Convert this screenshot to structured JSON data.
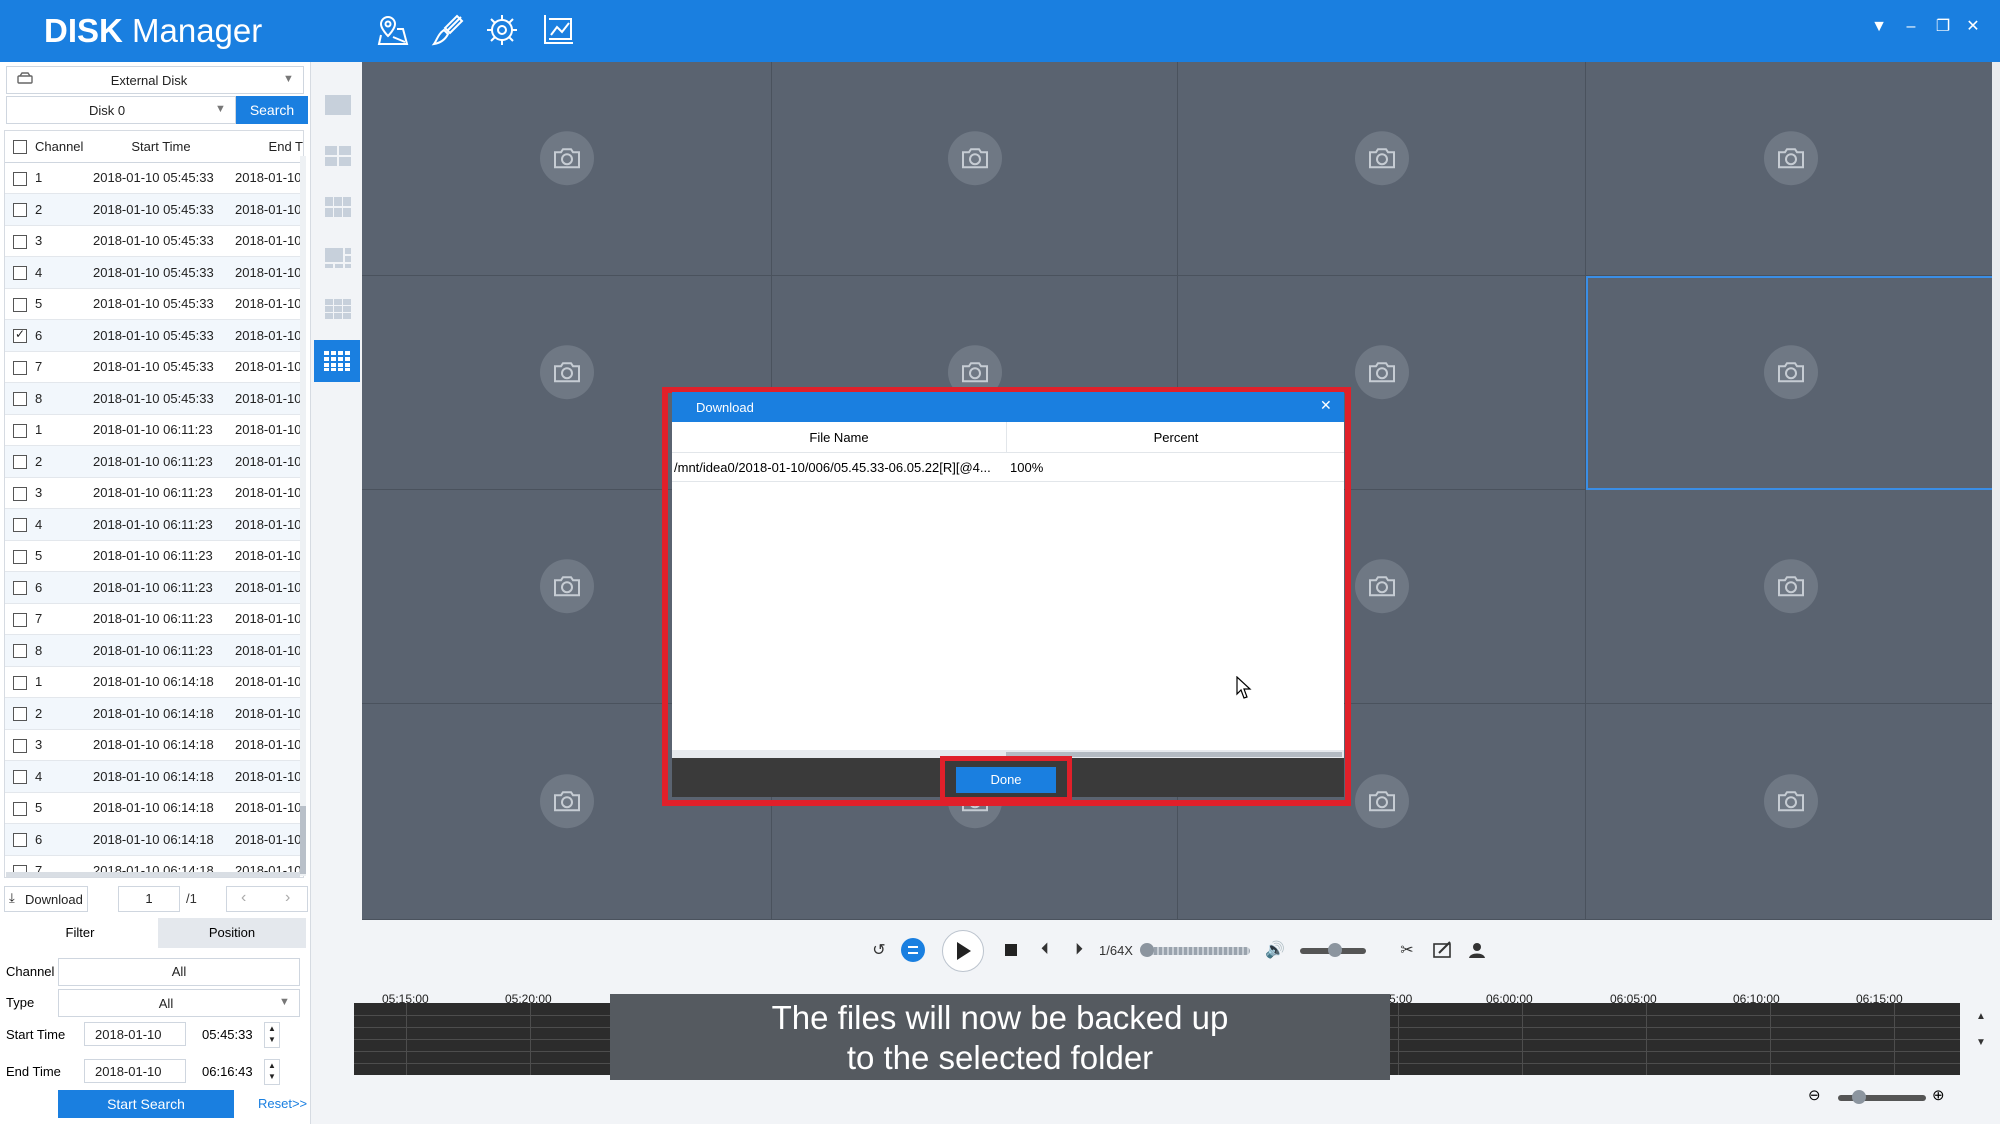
{
  "app": {
    "title_bold": "DISK",
    "title_rest": " Manager"
  },
  "toolbar_icons": [
    "map-pin-icon",
    "brush-icon",
    "gear-icon",
    "chart-icon"
  ],
  "window_buttons": {
    "menu": "▼",
    "minimize": "–",
    "restore": "❐",
    "close": "✕"
  },
  "left": {
    "disk_type": "External Disk",
    "disk": "Disk 0",
    "search_label": "Search",
    "columns": {
      "channel": "Channel",
      "start": "Start Time",
      "end": "End T"
    },
    "rows": [
      {
        "ch": "1",
        "start": "2018-01-10 05:45:33",
        "end": "2018-01-10",
        "checked": false
      },
      {
        "ch": "2",
        "start": "2018-01-10 05:45:33",
        "end": "2018-01-10",
        "checked": false
      },
      {
        "ch": "3",
        "start": "2018-01-10 05:45:33",
        "end": "2018-01-10",
        "checked": false
      },
      {
        "ch": "4",
        "start": "2018-01-10 05:45:33",
        "end": "2018-01-10",
        "checked": false
      },
      {
        "ch": "5",
        "start": "2018-01-10 05:45:33",
        "end": "2018-01-10",
        "checked": false
      },
      {
        "ch": "6",
        "start": "2018-01-10 05:45:33",
        "end": "2018-01-10",
        "checked": true
      },
      {
        "ch": "7",
        "start": "2018-01-10 05:45:33",
        "end": "2018-01-10",
        "checked": false
      },
      {
        "ch": "8",
        "start": "2018-01-10 05:45:33",
        "end": "2018-01-10",
        "checked": false
      },
      {
        "ch": "1",
        "start": "2018-01-10 06:11:23",
        "end": "2018-01-10",
        "checked": false
      },
      {
        "ch": "2",
        "start": "2018-01-10 06:11:23",
        "end": "2018-01-10",
        "checked": false
      },
      {
        "ch": "3",
        "start": "2018-01-10 06:11:23",
        "end": "2018-01-10",
        "checked": false
      },
      {
        "ch": "4",
        "start": "2018-01-10 06:11:23",
        "end": "2018-01-10",
        "checked": false
      },
      {
        "ch": "5",
        "start": "2018-01-10 06:11:23",
        "end": "2018-01-10",
        "checked": false
      },
      {
        "ch": "6",
        "start": "2018-01-10 06:11:23",
        "end": "2018-01-10",
        "checked": false
      },
      {
        "ch": "7",
        "start": "2018-01-10 06:11:23",
        "end": "2018-01-10",
        "checked": false
      },
      {
        "ch": "8",
        "start": "2018-01-10 06:11:23",
        "end": "2018-01-10",
        "checked": false
      },
      {
        "ch": "1",
        "start": "2018-01-10 06:14:18",
        "end": "2018-01-10",
        "checked": false
      },
      {
        "ch": "2",
        "start": "2018-01-10 06:14:18",
        "end": "2018-01-10",
        "checked": false
      },
      {
        "ch": "3",
        "start": "2018-01-10 06:14:18",
        "end": "2018-01-10",
        "checked": false
      },
      {
        "ch": "4",
        "start": "2018-01-10 06:14:18",
        "end": "2018-01-10",
        "checked": false
      },
      {
        "ch": "5",
        "start": "2018-01-10 06:14:18",
        "end": "2018-01-10",
        "checked": false
      },
      {
        "ch": "6",
        "start": "2018-01-10 06:14:18",
        "end": "2018-01-10",
        "checked": false
      },
      {
        "ch": "7",
        "start": "2018-01-10 06:14:18",
        "end": "2018-01-10",
        "checked": false
      }
    ],
    "download_label": "Download",
    "page_value": "1",
    "page_total": "/1",
    "tabs": {
      "filter": "Filter",
      "position": "Position"
    },
    "filter": {
      "channel_label": "Channel",
      "channel_value": "All",
      "type_label": "Type",
      "type_value": "All",
      "start_label": "Start Time",
      "start_date": "2018-01-10",
      "start_time": "05:45:33",
      "end_label": "End Time",
      "end_date": "2018-01-10",
      "end_time": "06:16:43"
    },
    "start_search_label": "Start Search",
    "reset_label": "Reset>>"
  },
  "dialog": {
    "title": "Download",
    "col_file": "File Name",
    "col_percent": "Percent",
    "file_name": "/mnt/idea0/2018-01-10/006/05.45.33-06.05.22[R][@4...",
    "percent": "100%",
    "done_label": "Done"
  },
  "controls": {
    "speed": "1/64X"
  },
  "timeline": {
    "labels": [
      "05:15:00",
      "05:20:00",
      "5:00",
      "06:00:00",
      "06:05:00",
      "06:10:00",
      "06:15:00"
    ]
  },
  "caption": {
    "line1": "The files will now be backed up",
    "line2": "to the selected folder"
  },
  "colors": {
    "accent": "#1a7fe0",
    "highlight": "#e0202a",
    "grid_bg": "#5a6370"
  }
}
